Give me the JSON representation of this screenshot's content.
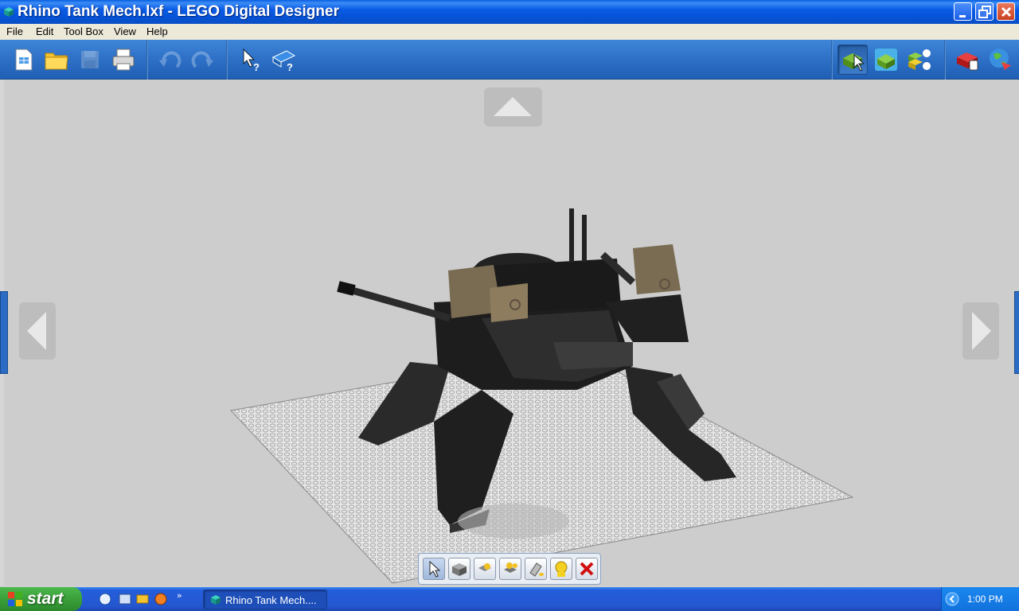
{
  "window": {
    "title": "Rhino Tank Mech.lxf - LEGO Digital Designer",
    "controls": [
      "minimize",
      "restore",
      "close"
    ]
  },
  "menu": [
    "File",
    "Edit",
    "Tool Box",
    "View",
    "Help"
  ],
  "toolbar": {
    "left_buttons": [
      {
        "name": "new-model-button",
        "icon": "new-file-icon"
      },
      {
        "name": "open-button",
        "icon": "folder-icon"
      },
      {
        "name": "save-button",
        "icon": "disk-icon",
        "disabled": true
      },
      {
        "name": "print-button",
        "icon": "printer-icon"
      },
      {
        "name": "undo-button",
        "icon": "undo-icon",
        "disabled": true
      },
      {
        "name": "redo-button",
        "icon": "redo-icon",
        "disabled": true
      },
      {
        "name": "help-pointer-button",
        "icon": "pointer-help-icon"
      },
      {
        "name": "help-book-button",
        "icon": "book-help-icon"
      }
    ],
    "right_buttons": [
      {
        "name": "build-mode-button",
        "icon": "build-mode-icon",
        "active": true
      },
      {
        "name": "view-mode-button",
        "icon": "view-mode-icon"
      },
      {
        "name": "building-guide-mode-button",
        "icon": "building-guide-icon"
      },
      {
        "name": "shop-button",
        "icon": "lego-shop-icon"
      },
      {
        "name": "upload-button",
        "icon": "globe-upload-icon"
      }
    ]
  },
  "palette": {
    "tools": [
      "select-tool",
      "clone-tool",
      "hinge-tool",
      "hinge-align-tool",
      "paint-tool",
      "hide-tool",
      "delete-tool"
    ],
    "selected": "select-tool"
  },
  "taskbar": {
    "start_label": "start",
    "task_label": "Rhino Tank Mech....",
    "clock": "1:00 PM"
  },
  "colors": {
    "titlebar": "#0553d8",
    "toolbar": "#2f72c8",
    "canvas": "#cdcdcd",
    "taskbar": "#245edb",
    "start": "#3a9f3a"
  }
}
